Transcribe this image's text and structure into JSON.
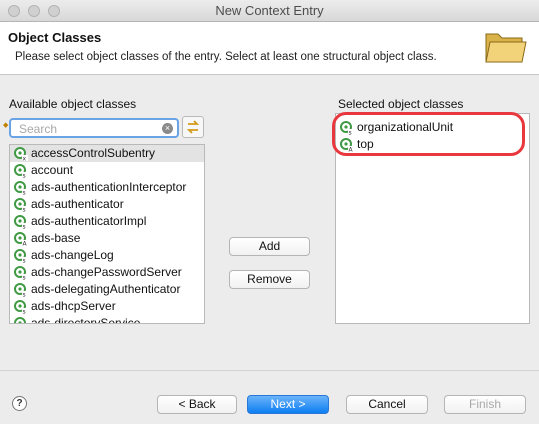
{
  "window": {
    "title": "New Context Entry"
  },
  "header": {
    "title": "Object Classes",
    "description": "Please select object classes of the entry. Select at least one structural object class.",
    "icon": "folder-icon"
  },
  "available": {
    "label": "Available object classes",
    "search_placeholder": "Search",
    "items": [
      "accessControlSubentry",
      "account",
      "ads-authenticationInterceptor",
      "ads-authenticator",
      "ads-authenticatorImpl",
      "ads-base",
      "ads-changeLog",
      "ads-changePasswordServer",
      "ads-delegatingAuthenticator",
      "ads-dhcpServer",
      "ads-directoryService"
    ]
  },
  "selected": {
    "label": "Selected object classes",
    "items": [
      "organizationalUnit",
      "top"
    ]
  },
  "actions": {
    "add": "Add",
    "remove": "Remove"
  },
  "footer": {
    "help": "?",
    "back": "< Back",
    "next": "Next >",
    "cancel": "Cancel",
    "finish": "Finish"
  },
  "colors": {
    "accent": "#0d7ef2",
    "annotation": "#e8383d",
    "icon_green": "#3f9a43"
  }
}
